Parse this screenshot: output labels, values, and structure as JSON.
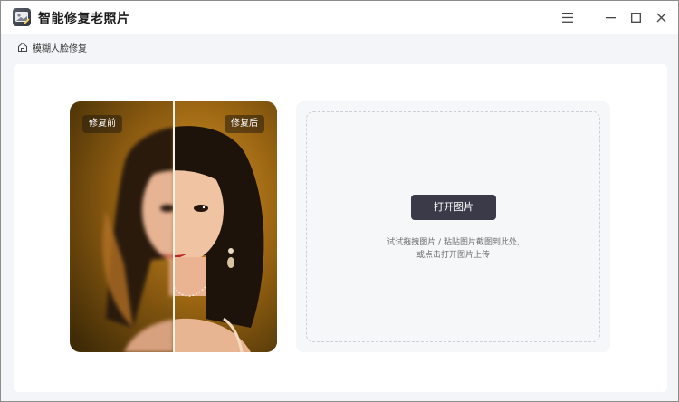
{
  "app": {
    "title": "智能修复老照片",
    "logo_icon": "photo-repair-logo-icon"
  },
  "window_controls": {
    "menu_icon": "hamburger-menu-icon",
    "minimize_icon": "minimize-icon",
    "maximize_icon": "maximize-icon",
    "close_icon": "close-icon"
  },
  "breadcrumb": {
    "home_icon": "home-icon",
    "label": "模糊人脸修复"
  },
  "compare": {
    "before_label": "修复前",
    "after_label": "修复后"
  },
  "upload": {
    "button_label": "打开图片",
    "hint_line1": "试试拖拽图片 / 粘贴图片截图到此处,",
    "hint_line2": "或点击打开图片上传"
  },
  "colors": {
    "accent_button": "#3b3a48",
    "page_background": "#f4f5f8",
    "portrait_backdrop": "#8a5a10"
  }
}
